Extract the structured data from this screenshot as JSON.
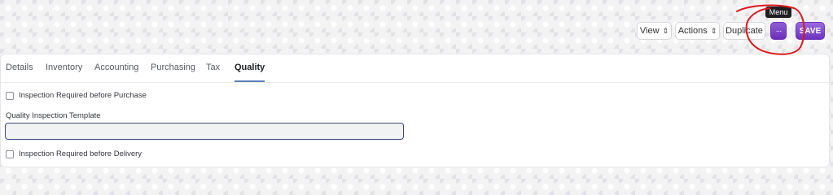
{
  "toolbar": {
    "view_label": "View",
    "actions_label": "Actions",
    "duplicate_label": "Duplicate",
    "menu_icon": "ellipsis-icon",
    "menu_glyph": "···",
    "save_label": "SAVE",
    "tooltip_text": "Menu",
    "accent_color": "#7a3fc8"
  },
  "tabs": [
    {
      "label": "Details"
    },
    {
      "label": "Inventory"
    },
    {
      "label": "Accounting"
    },
    {
      "label": "Purchasing"
    },
    {
      "label": "Tax"
    },
    {
      "label": "Quality",
      "active": true
    }
  ],
  "quality": {
    "inspection_purchase_label": "Inspection Required before Purchase",
    "inspection_purchase_checked": false,
    "template_label": "Quality Inspection Template",
    "template_value": "",
    "inspection_delivery_label": "Inspection Required before Delivery",
    "inspection_delivery_checked": false
  },
  "annotation": {
    "color": "#e0161b"
  }
}
